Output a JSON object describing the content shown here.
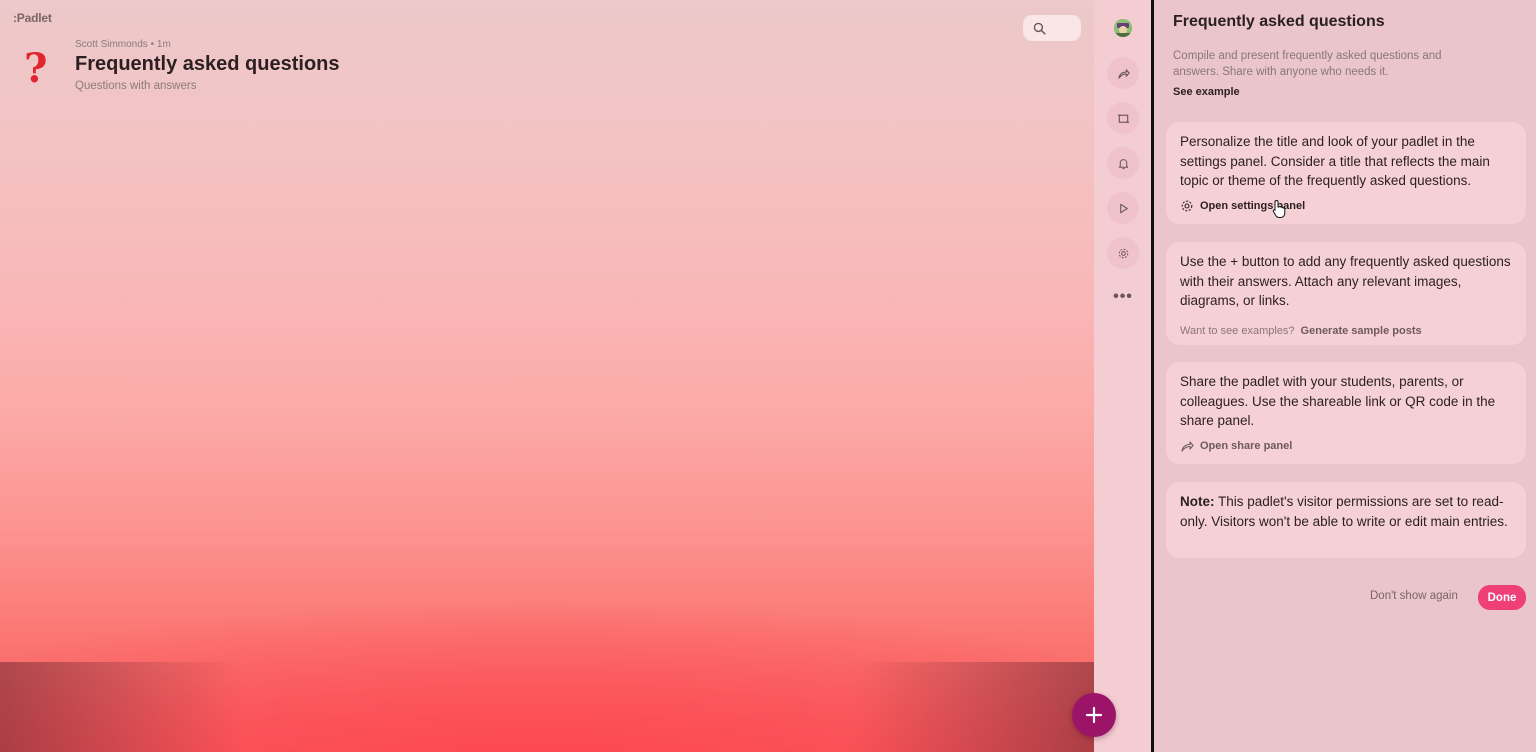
{
  "app": {
    "logo": "Padlet"
  },
  "padlet": {
    "author": "Scott Simmonds",
    "time": "1m",
    "meta_sep": "•",
    "title": "Frequently asked questions",
    "subtitle": "Questions with answers",
    "emoji_icon": "question-mark-icon"
  },
  "toolbar": {
    "buttons": [
      "share-icon",
      "remake-icon",
      "bell-icon",
      "play-icon",
      "gear-icon"
    ],
    "more": "•••"
  },
  "panel": {
    "title": "Frequently asked questions",
    "description": "Compile and present frequently asked questions and answers. Share with anyone who needs it.",
    "see_example": "See example",
    "cards": [
      {
        "text": "Personalize the title and look of your padlet in the settings panel. Consider a title that reflects the main topic or theme of the frequently asked questions.",
        "action_label": "Open settings panel"
      },
      {
        "text": "Use the + button to add any frequently asked questions with their answers. Attach any relevant images, diagrams, or links.",
        "action_prefix": "Want to see examples?",
        "action_label": "Generate sample posts"
      },
      {
        "text": "Share the padlet with your students, parents, or colleagues. Use the shareable link or QR code in the share panel.",
        "action_label": "Open share panel"
      },
      {
        "note_label": "Note:",
        "text": "This padlet's visitor permissions are set to read-only. Visitors won't be able to write or edit main entries."
      }
    ],
    "dont_show_again": "Don't show again",
    "done": "Done"
  },
  "colors": {
    "accent_pink": "#ef3f79",
    "fab_purple": "#9c1467",
    "question_red": "#e1262d"
  }
}
